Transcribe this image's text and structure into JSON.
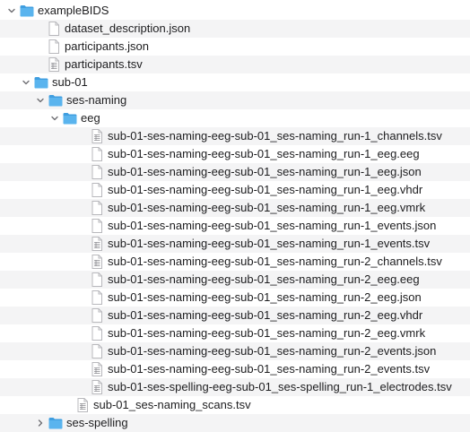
{
  "tree": {
    "rows": [
      {
        "label": "exampleBIDS",
        "kind": "folder",
        "depth": 0,
        "expanded": true,
        "icon": "folder-icon"
      },
      {
        "label": "dataset_description.json",
        "kind": "file",
        "depth": 1,
        "icon": "file-icon"
      },
      {
        "label": "participants.json",
        "kind": "file",
        "depth": 1,
        "icon": "file-icon"
      },
      {
        "label": "participants.tsv",
        "kind": "file-tsv",
        "depth": 1,
        "icon": "tsv-file-icon"
      },
      {
        "label": "sub-01",
        "kind": "folder",
        "depth": 1,
        "expanded": true,
        "icon": "folder-icon"
      },
      {
        "label": "ses-naming",
        "kind": "folder",
        "depth": 2,
        "expanded": true,
        "icon": "folder-icon"
      },
      {
        "label": "eeg",
        "kind": "folder",
        "depth": 3,
        "expanded": true,
        "icon": "folder-icon"
      },
      {
        "label": "sub-01-ses-naming-eeg-sub-01_ses-naming_run-1_channels.tsv",
        "kind": "file-tsv",
        "depth": 4,
        "icon": "tsv-file-icon"
      },
      {
        "label": "sub-01-ses-naming-eeg-sub-01_ses-naming_run-1_eeg.eeg",
        "kind": "file",
        "depth": 4,
        "icon": "file-icon"
      },
      {
        "label": "sub-01-ses-naming-eeg-sub-01_ses-naming_run-1_eeg.json",
        "kind": "file",
        "depth": 4,
        "icon": "file-icon"
      },
      {
        "label": "sub-01-ses-naming-eeg-sub-01_ses-naming_run-1_eeg.vhdr",
        "kind": "file",
        "depth": 4,
        "icon": "file-icon"
      },
      {
        "label": "sub-01-ses-naming-eeg-sub-01_ses-naming_run-1_eeg.vmrk",
        "kind": "file",
        "depth": 4,
        "icon": "file-icon"
      },
      {
        "label": "sub-01-ses-naming-eeg-sub-01_ses-naming_run-1_events.json",
        "kind": "file",
        "depth": 4,
        "icon": "file-icon"
      },
      {
        "label": "sub-01-ses-naming-eeg-sub-01_ses-naming_run-1_events.tsv",
        "kind": "file-tsv",
        "depth": 4,
        "icon": "tsv-file-icon"
      },
      {
        "label": "sub-01-ses-naming-eeg-sub-01_ses-naming_run-2_channels.tsv",
        "kind": "file-tsv",
        "depth": 4,
        "icon": "tsv-file-icon"
      },
      {
        "label": "sub-01-ses-naming-eeg-sub-01_ses-naming_run-2_eeg.eeg",
        "kind": "file",
        "depth": 4,
        "icon": "file-icon"
      },
      {
        "label": "sub-01-ses-naming-eeg-sub-01_ses-naming_run-2_eeg.json",
        "kind": "file",
        "depth": 4,
        "icon": "file-icon"
      },
      {
        "label": "sub-01-ses-naming-eeg-sub-01_ses-naming_run-2_eeg.vhdr",
        "kind": "file",
        "depth": 4,
        "icon": "file-icon"
      },
      {
        "label": "sub-01-ses-naming-eeg-sub-01_ses-naming_run-2_eeg.vmrk",
        "kind": "file",
        "depth": 4,
        "icon": "file-icon"
      },
      {
        "label": "sub-01-ses-naming-eeg-sub-01_ses-naming_run-2_events.json",
        "kind": "file",
        "depth": 4,
        "icon": "file-icon"
      },
      {
        "label": "sub-01-ses-naming-eeg-sub-01_ses-naming_run-2_events.tsv",
        "kind": "file-tsv",
        "depth": 4,
        "icon": "tsv-file-icon"
      },
      {
        "label": "sub-01-ses-spelling-eeg-sub-01_ses-spelling_run-1_electrodes.tsv",
        "kind": "file-tsv",
        "depth": 4,
        "icon": "tsv-file-icon"
      },
      {
        "label": "sub-01_ses-naming_scans.tsv",
        "kind": "file-tsv",
        "depth": 3,
        "icon": "tsv-file-icon"
      },
      {
        "label": "ses-spelling",
        "kind": "folder",
        "depth": 2,
        "expanded": false,
        "icon": "folder-icon"
      }
    ]
  },
  "colors": {
    "folder_body": "#5ab4ee",
    "folder_tab": "#3f9ee0",
    "file_stroke": "#b8b8bc",
    "stripe": "#f4f4f5",
    "text": "#1d1d1f"
  }
}
